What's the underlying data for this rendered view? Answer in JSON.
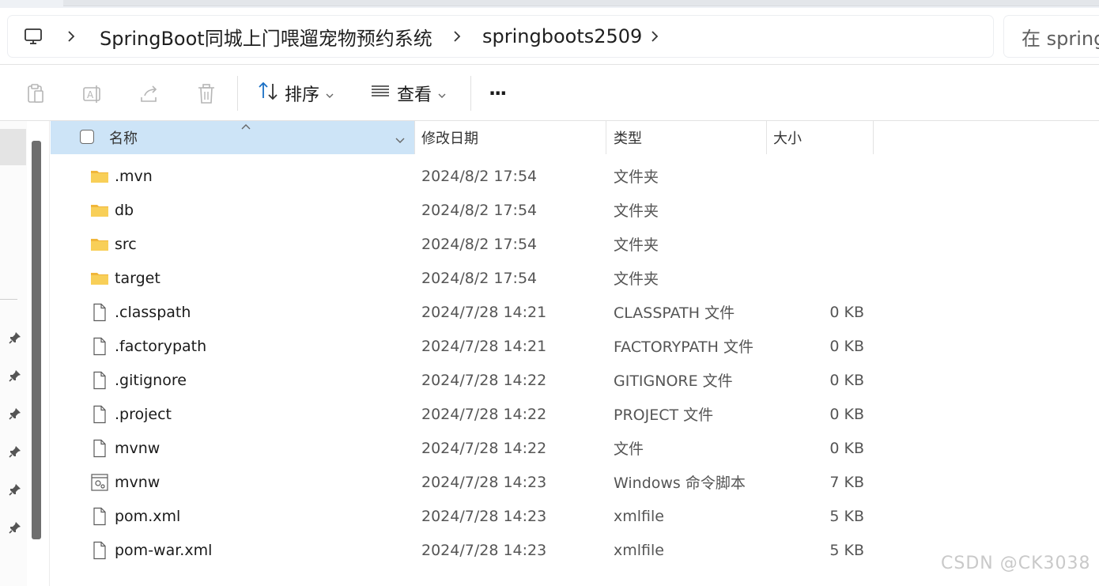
{
  "breadcrumb": {
    "items": [
      "SpringBoot同城上门喂遛宠物预约系统",
      "springboots2509"
    ]
  },
  "search": {
    "value": "在 spring"
  },
  "toolbar": {
    "sort_label": "排序",
    "view_label": "查看",
    "more_label": "···"
  },
  "columns": {
    "name": "名称",
    "date": "修改日期",
    "type": "类型",
    "size": "大小"
  },
  "files": [
    {
      "name": ".mvn",
      "date": "2024/8/2 17:54",
      "type": "文件夹",
      "size": "",
      "icon": "folder-icon"
    },
    {
      "name": "db",
      "date": "2024/8/2 17:54",
      "type": "文件夹",
      "size": "",
      "icon": "folder-icon"
    },
    {
      "name": "src",
      "date": "2024/8/2 17:54",
      "type": "文件夹",
      "size": "",
      "icon": "folder-icon"
    },
    {
      "name": "target",
      "date": "2024/8/2 17:54",
      "type": "文件夹",
      "size": "",
      "icon": "folder-icon"
    },
    {
      "name": ".classpath",
      "date": "2024/7/28 14:21",
      "type": "CLASSPATH 文件",
      "size": "0 KB",
      "icon": "file-icon"
    },
    {
      "name": ".factorypath",
      "date": "2024/7/28 14:21",
      "type": "FACTORYPATH 文件",
      "size": "0 KB",
      "icon": "file-icon"
    },
    {
      "name": ".gitignore",
      "date": "2024/7/28 14:22",
      "type": "GITIGNORE 文件",
      "size": "0 KB",
      "icon": "file-icon"
    },
    {
      "name": ".project",
      "date": "2024/7/28 14:22",
      "type": "PROJECT 文件",
      "size": "0 KB",
      "icon": "file-icon"
    },
    {
      "name": "mvnw",
      "date": "2024/7/28 14:22",
      "type": "文件",
      "size": "0 KB",
      "icon": "file-icon"
    },
    {
      "name": "mvnw",
      "date": "2024/7/28 14:23",
      "type": "Windows 命令脚本",
      "size": "7 KB",
      "icon": "script-icon"
    },
    {
      "name": "pom.xml",
      "date": "2024/7/28 14:23",
      "type": "xmlfile",
      "size": "5 KB",
      "icon": "file-icon"
    },
    {
      "name": "pom-war.xml",
      "date": "2024/7/28 14:23",
      "type": "xmlfile",
      "size": "5 KB",
      "icon": "file-icon"
    }
  ],
  "watermark": "CSDN @CK3038",
  "colors": {
    "selected_header": "#cde4f7",
    "folder": "#f5c542",
    "accent": "#1a6fc4"
  }
}
